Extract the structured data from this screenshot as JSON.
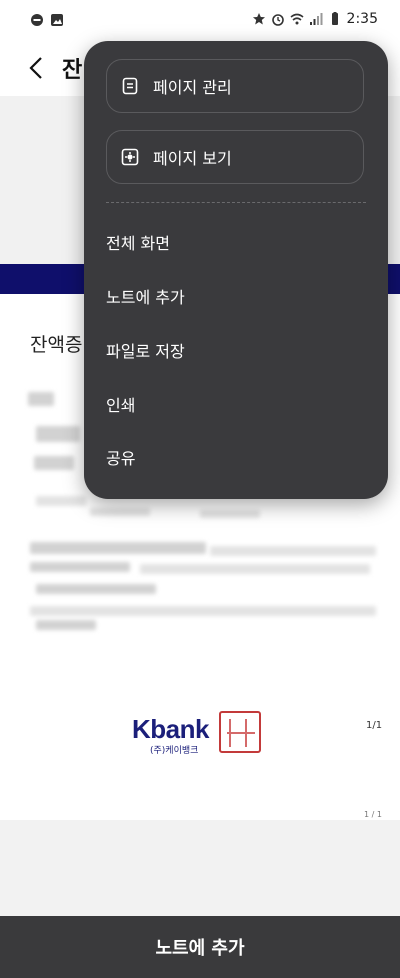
{
  "status_bar": {
    "time": "2:35"
  },
  "app_bar": {
    "title": "잔"
  },
  "document": {
    "heading": "잔액증",
    "brand_logo": "Kbank",
    "brand_sub": "(주)케이뱅크",
    "page_number": "1/1",
    "page_number_small": "1 / 1"
  },
  "menu": {
    "cards": [
      {
        "label": "페이지 관리",
        "icon": "page-list-icon"
      },
      {
        "label": "페이지 보기",
        "icon": "page-view-icon"
      }
    ],
    "items": [
      {
        "label": "전체 화면"
      },
      {
        "label": "노트에 추가"
      },
      {
        "label": "파일로 저장"
      },
      {
        "label": "인쇄"
      },
      {
        "label": "공유"
      }
    ]
  },
  "bottom_bar": {
    "label": "노트에 추가"
  },
  "colors": {
    "menu_bg": "#3a3a3d",
    "navy_band": "#0f0f6b",
    "brand_text": "#1b1f7a",
    "seal_red": "#c33a3a",
    "bottom_bar_bg": "#3a3a3c"
  }
}
